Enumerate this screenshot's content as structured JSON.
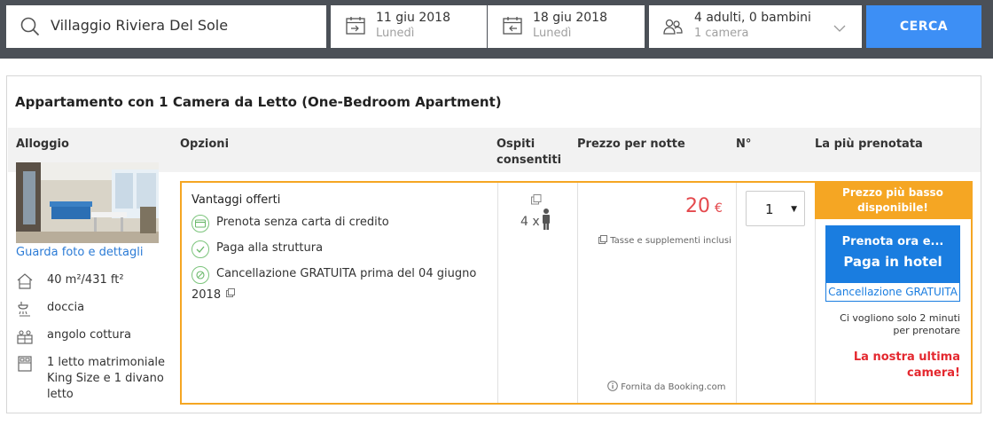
{
  "search": {
    "destination": "Villaggio Riviera Del Sole",
    "checkin_date": "11 giu 2018",
    "checkin_day": "Lunedì",
    "checkout_date": "18 giu 2018",
    "checkout_day": "Lunedì",
    "guests_line1": "4 adulti, 0 bambini",
    "guests_line2": "1 camera",
    "search_button": "CERCA"
  },
  "room": {
    "title": "Appartamento con 1 Camera da Letto (One-Bedroom Apartment)",
    "headers": {
      "accommodation": "Alloggio",
      "options": "Opzioni",
      "guests_line1": "Ospiti",
      "guests_line2": "consentiti",
      "price": "Prezzo per notte",
      "number": "N°",
      "most_booked": "La più prenotata"
    },
    "photo_link": "Guarda foto e dettagli",
    "features": [
      {
        "icon": "house-icon",
        "label": "40 m²/431 ft²"
      },
      {
        "icon": "shower-icon",
        "label": "doccia"
      },
      {
        "icon": "kitchenette-icon",
        "label": "angolo cottura"
      },
      {
        "icon": "bed-icon",
        "label": "1 letto matrimoniale King Size e 1 divano letto"
      }
    ],
    "benefits_title": "Vantaggi offerti",
    "benefits": [
      {
        "icon": "credit-card-icon",
        "label": "Prenota senza carta di credito"
      },
      {
        "icon": "pay-at-property-icon",
        "label": "Paga alla struttura"
      },
      {
        "icon": "cancel-icon",
        "label": "Cancellazione GRATUITA prima del 04 giugno",
        "label2": "2018"
      }
    ],
    "capacity": "4 x",
    "price": "20",
    "currency": "€",
    "taxes_note": "Tasse e supplementi inclusi",
    "provider": "Fornita da Booking.com",
    "quantity": "1",
    "best_price_line1": "Prezzo più basso",
    "best_price_line2": "disponibile!",
    "book_line1": "Prenota ora e...",
    "book_line2": "Paga in hotel",
    "free_cancellation": "Cancellazione GRATUITA",
    "note_line1": "Ci vogliono solo 2 minuti",
    "note_line2": "per prenotare",
    "last_room_line1": "La nostra ultima",
    "last_room_line2": "camera!"
  },
  "colors": {
    "topbar": "#4b5057",
    "accent_blue": "#3d8ff5",
    "book_blue": "#1a7de0",
    "orange": "#f5a623",
    "price_red": "#e4494d",
    "alert_red": "#e4282f"
  }
}
